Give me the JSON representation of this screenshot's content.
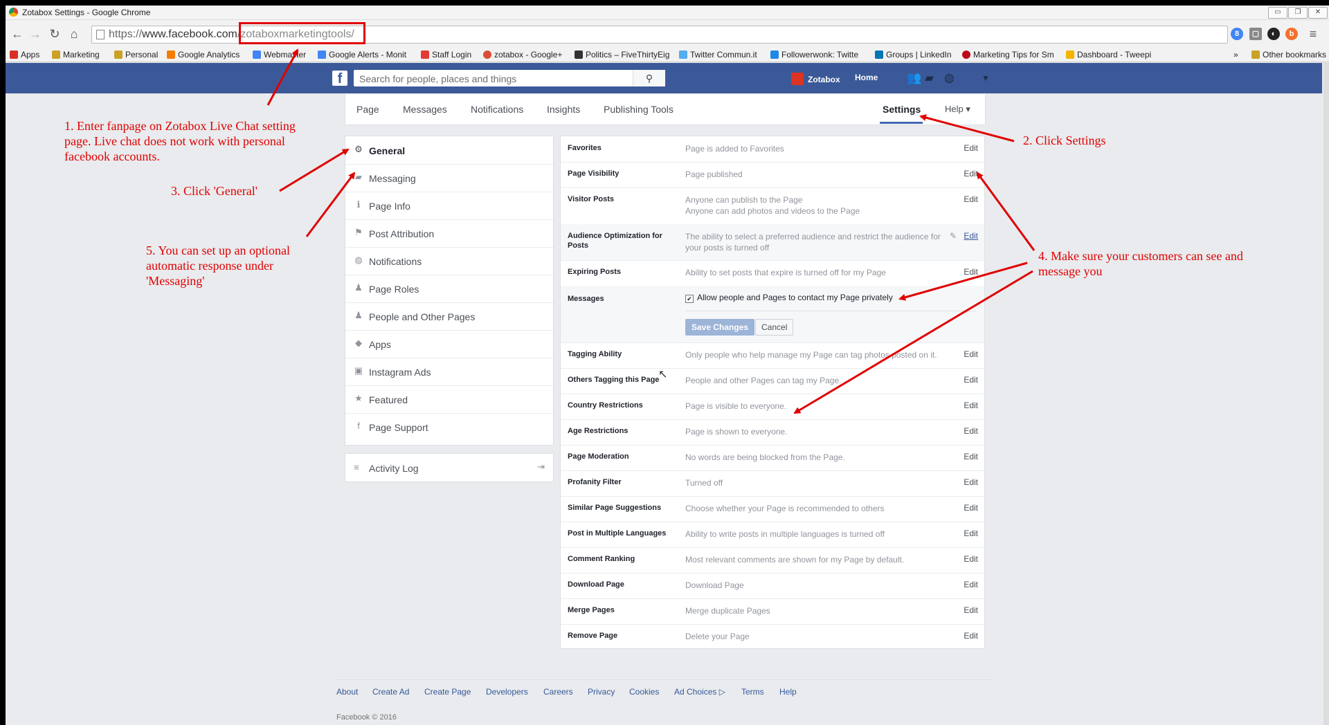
{
  "window": {
    "title": "Zotabox Settings - Google Chrome",
    "buttons": [
      "▭",
      "❐",
      "✕"
    ]
  },
  "browser": {
    "url_scheme": "https://",
    "url_host": "www.facebook.com",
    "url_path": "/zotaboxmarketingtools/",
    "bookmarks": [
      {
        "label": "Apps",
        "color": "#d93025"
      },
      {
        "label": "Marketing",
        "color": "#c9a227"
      },
      {
        "label": "Personal",
        "color": "#c9a227"
      },
      {
        "label": "Google Analytics",
        "color": "#f57c00"
      },
      {
        "label": "Webmaster",
        "color": "#4285f4"
      },
      {
        "label": "Google Alerts - Monit",
        "color": "#4285f4"
      },
      {
        "label": "Staff Login",
        "color": "#e53935"
      },
      {
        "label": "zotabox - Google+",
        "color": "#dd4b39"
      },
      {
        "label": "Politics – FiveThirtyEig",
        "color": "#333333"
      },
      {
        "label": "Twitter Commun.it",
        "color": "#55acee"
      },
      {
        "label": "Followerwonk: Twitte",
        "color": "#1e88e5"
      },
      {
        "label": "Groups | LinkedIn",
        "color": "#0077b5"
      },
      {
        "label": "Marketing Tips for Sm",
        "color": "#bd081c"
      },
      {
        "label": "Dashboard - Tweepi",
        "color": "#f4b400"
      }
    ],
    "bookmarks_more": "»",
    "other_bookmarks": "Other bookmarks"
  },
  "facebook": {
    "search_placeholder": "Search for people, places and things",
    "profile_name": "Zotabox",
    "home": "Home",
    "tabs": [
      "Page",
      "Messages",
      "Notifications",
      "Insights",
      "Publishing Tools"
    ],
    "settings_tab": "Settings",
    "help_tab": "Help ▾",
    "left_menu": [
      {
        "label": "General",
        "icon": "⚙"
      },
      {
        "label": "Messaging",
        "icon": "▰"
      },
      {
        "label": "Page Info",
        "icon": "ℹ"
      },
      {
        "label": "Post Attribution",
        "icon": "⚑"
      },
      {
        "label": "Notifications",
        "icon": "◍"
      },
      {
        "label": "Page Roles",
        "icon": "♟"
      },
      {
        "label": "People and Other Pages",
        "icon": "♟"
      },
      {
        "label": "Apps",
        "icon": "◆"
      },
      {
        "label": "Instagram Ads",
        "icon": "▣"
      },
      {
        "label": "Featured",
        "icon": "★"
      },
      {
        "label": "Page Support",
        "icon": "f"
      }
    ],
    "activity_log": "Activity Log",
    "settings": [
      {
        "name": "Favorites",
        "value": "Page is added to Favorites",
        "edit": "Edit"
      },
      {
        "name": "Page Visibility",
        "value": "Page published",
        "edit": "Edit"
      },
      {
        "name": "Visitor Posts",
        "value": "Anyone can publish to the Page",
        "value2": "Anyone can add photos and videos to the Page",
        "edit": "Edit"
      },
      {
        "name": "Audience Optimization for Posts",
        "value": "The ability to select a preferred audience and restrict the audience for your posts is turned off",
        "edit": "Edit"
      },
      {
        "name": "Expiring Posts",
        "value": "Ability to set posts that expire is turned off for my Page",
        "edit": "Edit"
      },
      {
        "name": "Messages",
        "value": "Allow people and Pages to contact my Page privately",
        "save": "Save Changes",
        "cancel": "Cancel"
      },
      {
        "name": "Tagging Ability",
        "value": "Only people who help manage my Page can tag photos posted on it.",
        "edit": "Edit"
      },
      {
        "name": "Others Tagging this Page",
        "value": "People and other Pages can tag my Page.",
        "edit": "Edit"
      },
      {
        "name": "Country Restrictions",
        "value": "Page is visible to everyone.",
        "edit": "Edit"
      },
      {
        "name": "Age Restrictions",
        "value": "Page is shown to everyone.",
        "edit": "Edit"
      },
      {
        "name": "Page Moderation",
        "value": "No words are being blocked from the Page.",
        "edit": "Edit"
      },
      {
        "name": "Profanity Filter",
        "value": "Turned off",
        "edit": "Edit"
      },
      {
        "name": "Similar Page Suggestions",
        "value": "Choose whether your Page is recommended to others",
        "edit": "Edit"
      },
      {
        "name": "Post in Multiple Languages",
        "value": "Ability to write posts in multiple languages is turned off",
        "edit": "Edit"
      },
      {
        "name": "Comment Ranking",
        "value": "Most relevant comments are shown for my Page by default.",
        "edit": "Edit"
      },
      {
        "name": "Download Page",
        "value": "Download Page",
        "edit": "Edit"
      },
      {
        "name": "Merge Pages",
        "value": "Merge duplicate Pages",
        "edit": "Edit"
      },
      {
        "name": "Remove Page",
        "value": "Delete your Page",
        "edit": "Edit"
      }
    ],
    "footer_links": [
      "About",
      "Create Ad",
      "Create Page",
      "Developers",
      "Careers",
      "Privacy",
      "Cookies",
      "Ad Choices",
      "Terms",
      "Help"
    ],
    "copyright": "Facebook © 2016"
  },
  "annotations": {
    "step1": "1. Enter fanpage on Zotabox Live Chat setting page. Live chat does not work with personal facebook accounts.",
    "step2": "2. Click Settings",
    "step3": "3. Click 'General'",
    "step4": "4. Make sure your customers can see and message you",
    "step5": "5. You can set up an optional automatic response under 'Messaging'"
  }
}
